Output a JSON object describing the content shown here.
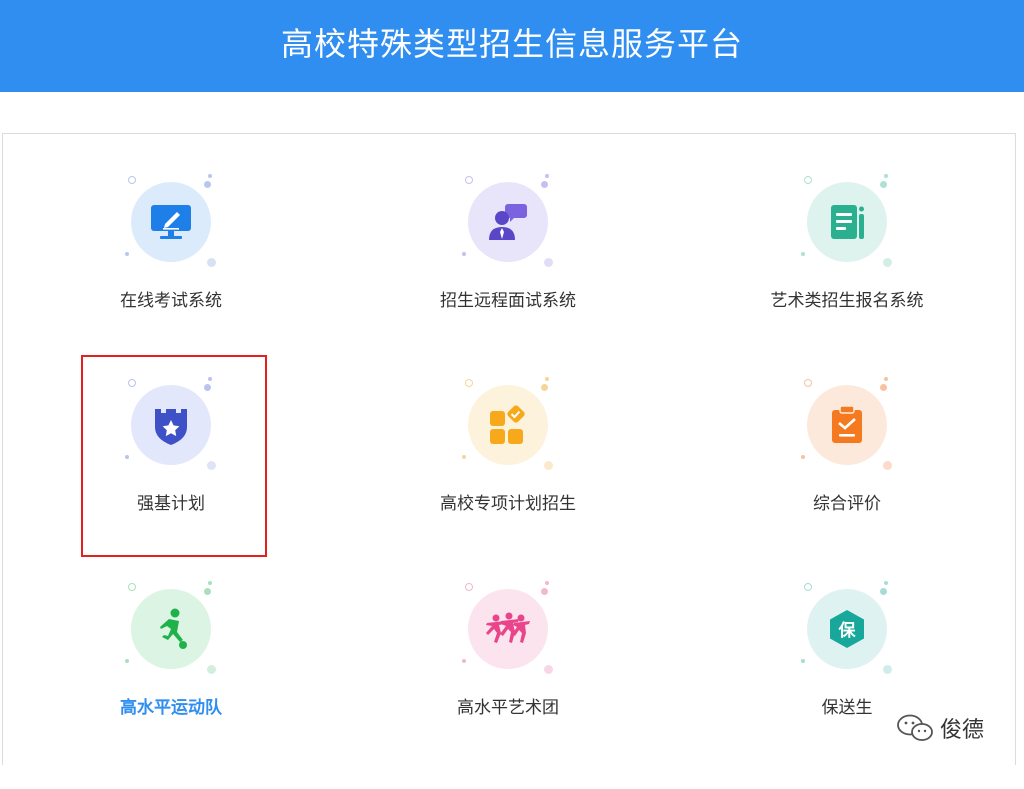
{
  "header": {
    "title": "高校特殊类型招生信息服务平台"
  },
  "tiles": [
    {
      "label": "在线考试系统"
    },
    {
      "label": "招生远程面试系统"
    },
    {
      "label": "艺术类招生报名系统"
    },
    {
      "label": "强基计划"
    },
    {
      "label": "高校专项计划招生"
    },
    {
      "label": "综合评价"
    },
    {
      "label": "高水平运动队"
    },
    {
      "label": "高水平艺术团"
    },
    {
      "label": "保送生",
      "badge": "保"
    }
  ],
  "watermark": {
    "text": "俊德"
  },
  "colors": {
    "header": "#2f8ef0",
    "highlight": "#e32020",
    "active_label": "#2f8ef0"
  }
}
